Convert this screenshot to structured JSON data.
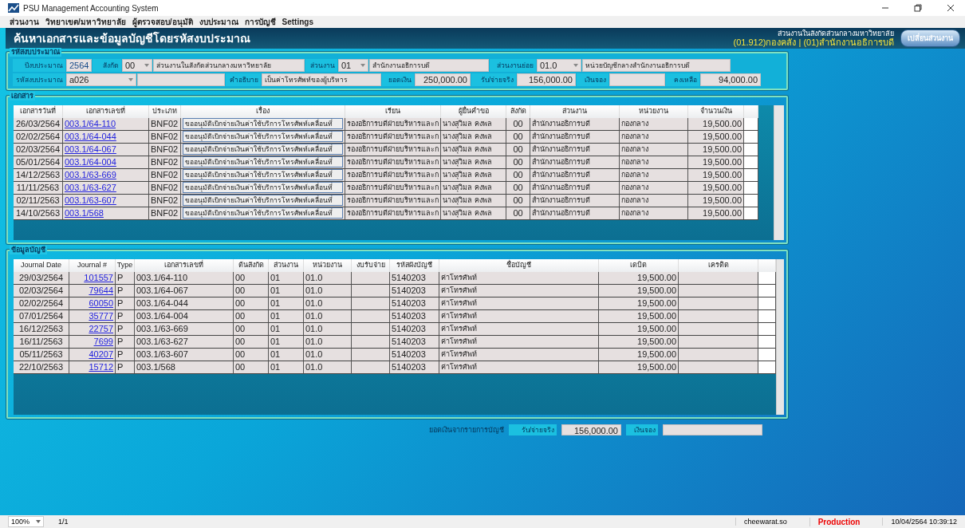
{
  "window": {
    "title": "PSU Management Accounting System"
  },
  "menu": [
    "ส่วนงาน",
    "วิทยาเขต/มหาวิทยาลัย",
    "ผู้ตรวจสอบ/อนุมัติ",
    "งบประมาณ",
    "การบัญชี",
    "Settings"
  ],
  "header": {
    "title": "ค้นหาเอกสารและข้อมูลบัญชีโดยรหัสงบประมาณ",
    "unit_caption": "ส่วนงานในสังกัดส่วนกลางมหาวิทยาลัย",
    "unit_path": "(01.912)กองคลัง  | (01)สำนักงานอธิการบดี",
    "change_button": "เปลี่ยนส่วนงาน"
  },
  "budget": {
    "legend": "รหัสงบประมาณ",
    "fields": [
      {
        "label": "ปีงบประมาณ",
        "kind": "number",
        "value": "2564"
      },
      {
        "label": "สังกัด",
        "kind": "dropdown",
        "value": "00",
        "name": "ส่วนงานในสังกัดส่วนกลางมหาวิทยาลัย"
      },
      {
        "label": "ส่วนงาน",
        "kind": "dropdown",
        "value": "01",
        "name": "สำนักงานอธิการบดี"
      },
      {
        "label": "ส่วนงานย่อย",
        "kind": "dropdown",
        "value": "01.0",
        "name": "หน่วยบัญชีกลางสำนักงานอธิการบดี"
      },
      {
        "label": "รหัสงบประมาณ",
        "kind": "dropdown",
        "value": "a026"
      },
      {
        "label": "คำอธิบาย",
        "kind": "text",
        "value": "เป็นค่าโทรศัพท์ของผู้บริหาร"
      },
      {
        "label": "ยอดเงิน",
        "kind": "number",
        "value": "250,000.00"
      },
      {
        "label": "รับ/จ่ายจริง",
        "kind": "number",
        "value": "156,000.00"
      },
      {
        "label": "เงินจอง",
        "kind": "number"
      },
      {
        "label": "คงเหลือ",
        "kind": "number",
        "value": "94,000.00"
      }
    ]
  },
  "documents": {
    "legend": "เอกสาร",
    "columns": [
      "เอกสารวันที่",
      "เอกสารเลขที่",
      "ประเภท",
      "เรื่อง",
      "เรียน",
      "ผู้ยื่นคำขอ",
      "สังกัด",
      "ส่วนงาน",
      "หน่วยงาน",
      "จำนวนเงิน"
    ],
    "rows": [
      [
        "26/03/2564",
        "003.1/64-110",
        "BNF02",
        "ขออนุมัติเบิกจ่ายเงินค่าใช้บริการโทรศัพท์เคลื่อนที่",
        "รองอธิการบดีฝ่ายบริหารและก",
        "นางสุวิมล  คงพล",
        "00",
        "สำนักงานอธิการบดี",
        "กองกลาง",
        "19,500.00"
      ],
      [
        "02/02/2564",
        "003.1/64-044",
        "BNF02",
        "ขออนุมัติเบิกจ่ายเงินค่าใช้บริการโทรศัพท์เคลื่อนที่",
        "รองอธิการบดีฝ่ายบริหารและก",
        "นางสุวิมล  คงพล",
        "00",
        "สำนักงานอธิการบดี",
        "กองกลาง",
        "19,500.00"
      ],
      [
        "02/03/2564",
        "003.1/64-067",
        "BNF02",
        "ขออนุมัติเบิกจ่ายเงินค่าใช้บริการโทรศัพท์เคลื่อนที่",
        "รองอธิการบดีฝ่ายบริหารและก",
        "นางสุวิมล  คงพล",
        "00",
        "สำนักงานอธิการบดี",
        "กองกลาง",
        "19,500.00"
      ],
      [
        "05/01/2564",
        "003.1/64-004",
        "BNF02",
        "ขออนุมัติเบิกจ่ายเงินค่าใช้บริการโทรศัพท์เคลื่อนที่",
        "รองอธิการบดีฝ่ายบริหารและก",
        "นางสุวิมล  คงพล",
        "00",
        "สำนักงานอธิการบดี",
        "กองกลาง",
        "19,500.00"
      ],
      [
        "14/12/2563",
        "003.1/63-669",
        "BNF02",
        "ขออนุมัติเบิกจ่ายเงินค่าใช้บริการโทรศัพท์เคลื่อนที่",
        "รองอธิการบดีฝ่ายบริหารและก",
        "นางสุวิมล  คงพล",
        "00",
        "สำนักงานอธิการบดี",
        "กองกลาง",
        "19,500.00"
      ],
      [
        "11/11/2563",
        "003.1/63-627",
        "BNF02",
        "ขออนุมัติเบิกจ่ายเงินค่าใช้บริการโทรศัพท์เคลื่อนที่",
        "รองอธิการบดีฝ่ายบริหารและก",
        "นางสุวิมล  คงพล",
        "00",
        "สำนักงานอธิการบดี",
        "กองกลาง",
        "19,500.00"
      ],
      [
        "02/11/2563",
        "003.1/63-607",
        "BNF02",
        "ขออนุมัติเบิกจ่ายเงินค่าใช้บริการโทรศัพท์เคลื่อนที่",
        "รองอธิการบดีฝ่ายบริหารและก",
        "นางสุวิมล  คงพล",
        "00",
        "สำนักงานอธิการบดี",
        "กองกลาง",
        "19,500.00"
      ],
      [
        "14/10/2563",
        "003.1/568",
        "BNF02",
        "ขออนุมัติเบิกจ่ายเงินค่าใช้บริการโทรศัพท์เคลื่อนที่",
        "รองอธิการบดีฝ่ายบริหารและก",
        "นางสุวิมล  คงพล",
        "00",
        "สำนักงานอธิการบดี",
        "กองกลาง",
        "19,500.00"
      ]
    ]
  },
  "accounts": {
    "legend": "ข้อมูลบัญชี",
    "columns": [
      "Journal Date",
      "Journal #",
      "Type",
      "เอกสารเลขที่",
      "ต้นสังกัด",
      "ส่วนงาน",
      "หน่วยงาน",
      "งบรับจ่าย",
      "รหัสผังบัญชี",
      "ชื่อบัญชี",
      "เดบิต",
      "เครดิต"
    ],
    "rows": [
      [
        "29/03/2564",
        "101557",
        "P",
        "003.1/64-110",
        "00",
        "01",
        "01.0",
        "",
        "5140203",
        "ค่าโทรศัพท์",
        "19,500.00",
        ""
      ],
      [
        "02/03/2564",
        "79644",
        "P",
        "003.1/64-067",
        "00",
        "01",
        "01.0",
        "",
        "5140203",
        "ค่าโทรศัพท์",
        "19,500.00",
        ""
      ],
      [
        "02/02/2564",
        "60050",
        "P",
        "003.1/64-044",
        "00",
        "01",
        "01.0",
        "",
        "5140203",
        "ค่าโทรศัพท์",
        "19,500.00",
        ""
      ],
      [
        "07/01/2564",
        "35777",
        "P",
        "003.1/64-004",
        "00",
        "01",
        "01.0",
        "",
        "5140203",
        "ค่าโทรศัพท์",
        "19,500.00",
        ""
      ],
      [
        "16/12/2563",
        "22757",
        "P",
        "003.1/63-669",
        "00",
        "01",
        "01.0",
        "",
        "5140203",
        "ค่าโทรศัพท์",
        "19,500.00",
        ""
      ],
      [
        "16/11/2563",
        "7699",
        "P",
        "003.1/63-627",
        "00",
        "01",
        "01.0",
        "",
        "5140203",
        "ค่าโทรศัพท์",
        "19,500.00",
        ""
      ],
      [
        "05/11/2563",
        "40207",
        "P",
        "003.1/63-607",
        "00",
        "01",
        "01.0",
        "",
        "5140203",
        "ค่าโทรศัพท์",
        "19,500.00",
        ""
      ],
      [
        "22/10/2563",
        "15712",
        "P",
        "003.1/568",
        "00",
        "01",
        "01.0",
        "",
        "5140203",
        "ค่าโทรศัพท์",
        "19,500.00",
        ""
      ]
    ]
  },
  "summary": {
    "caption": "ยอดเงินจากรายการบัญชี",
    "paid_label": "รับ/จ่ายจริง",
    "paid": "156,000.00",
    "reserved_label": "เงินจอง"
  },
  "status_bar": {
    "zoom": "100%",
    "page": "1/1",
    "user": "cheewarat.so",
    "environment": "Production",
    "datetime": "10/04/2564 10:39:12"
  }
}
